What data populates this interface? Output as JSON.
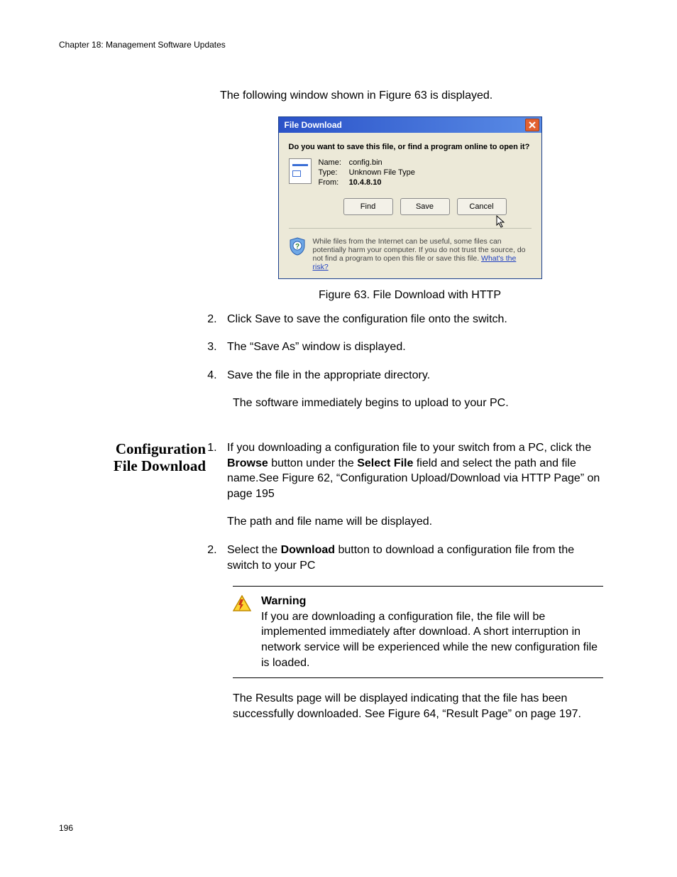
{
  "header": "Chapter 18: Management Software Updates",
  "pageNumber": "196",
  "intro": "The following window shown in Figure 63 is displayed.",
  "dialog": {
    "title": "File Download",
    "question": "Do you want to save this file, or find a program online to open it?",
    "nameLabel": "Name:",
    "nameValue": "config.bin",
    "typeLabel": "Type:",
    "typeValue": "Unknown File Type",
    "fromLabel": "From:",
    "fromValue": "10.4.8.10",
    "findBtn": "Find",
    "saveBtn": "Save",
    "cancelBtn": "Cancel",
    "infoText": "While files from the Internet can be useful, some files can potentially harm your computer. If you do not trust the source, do not find a program to open this file or save this file. ",
    "riskLink": "What's the risk?"
  },
  "caption": "Figure 63. File Download with HTTP",
  "steps1": {
    "s2": "Click Save to save the configuration file onto the switch.",
    "s3": "The “Save As” window is displayed.",
    "s4": "Save the file in the appropriate directory."
  },
  "upload_para": "The software immediately begins to upload to your PC.",
  "sidebar": {
    "line1": "Configuration",
    "line2": "File Download"
  },
  "steps2": {
    "s1_a": "If you downloading a configuration file to your switch from a PC, click the ",
    "s1_browse": "Browse",
    "s1_b": " button under the ",
    "s1_select": "Select File",
    "s1_c": " field and select the path and file name.See Figure 62, “Configuration Upload/Download via HTTP Page” on page 195",
    "path_para": "The path and file name will be displayed.",
    "s2_a": "Select the ",
    "s2_download": "Download",
    "s2_b": " button to download a configuration file from the switch to your PC"
  },
  "warning": {
    "title": "Warning",
    "body": "If you are downloading a configuration file, the file will be implemented immediately after download. A short interruption in network service will be experienced while the new configuration file is loaded."
  },
  "results_para": "The Results page will be displayed indicating that the file has been successfully downloaded. See Figure 64, “Result Page” on page 197."
}
